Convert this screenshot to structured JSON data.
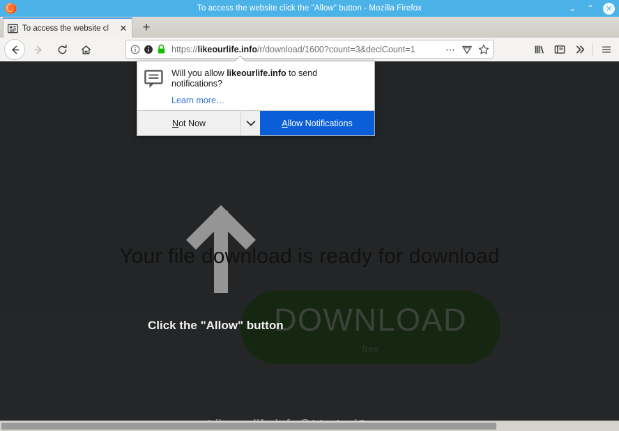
{
  "window": {
    "title": "To access the website click the \"Allow\" button - Mozilla Firefox",
    "minimize_label": "⌄",
    "maximize_label": "⌃",
    "close_label": "✕"
  },
  "tabs": {
    "active_tab_title": "To access the website cl",
    "close_label": "✕",
    "new_tab_label": "+"
  },
  "nav": {
    "back_label": "←",
    "forward_label": "→",
    "reload_label": "↻",
    "home_label": "⌂"
  },
  "urlbar": {
    "scheme": "https://",
    "host": "likeourlife.info",
    "path": "/r/download/1600?count=3&declCount=1",
    "full_url": "https://likeourlife.info/r/download/1600?count=3&declCount=1",
    "overflow_label": "⋯",
    "reader_label": "reader-view",
    "bookmark_label": "☆"
  },
  "toolbar_right": {
    "library_label": "library",
    "sidebar_label": "sidebar",
    "overflow_label": "»",
    "menu_label": "☰"
  },
  "popup": {
    "icon_name": "notification-bubble-icon",
    "question_prefix": "Will you allow ",
    "question_domain": "likeourlife.info",
    "question_suffix": " to send notifications?",
    "learn_more": "Learn more…",
    "not_now_label": "Not Now",
    "not_now_accesskey": "N",
    "dropdown_label": "⌄",
    "allow_label": "Allow Notifications",
    "allow_accesskey": "A",
    "allow_color": "#0a5fd8"
  },
  "page": {
    "headline": "Your file download is ready for download",
    "cta_note": "Click the \"Allow\" button",
    "download_button_label": "DOWNLOAD",
    "download_button_sub": "free",
    "download_button_color": "#17380f",
    "background_color": "#313335",
    "watermark": "Likeourlife.info@My AntiSpyware",
    "arrow_name": "up-arrow-graphic"
  },
  "scrollbar": {
    "orientation": "horizontal"
  }
}
